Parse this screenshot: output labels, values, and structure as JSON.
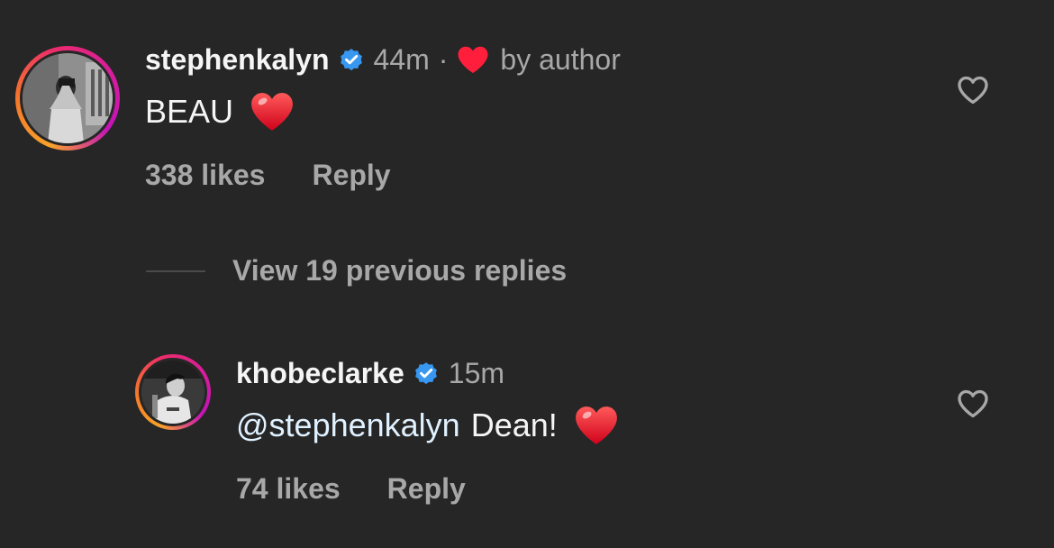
{
  "comments": [
    {
      "username": "stephenkalyn",
      "verified": true,
      "time": "44m",
      "separator": "·",
      "author_badge": "by author",
      "mention": "",
      "text": "BEAU",
      "likes": "338 likes",
      "reply_label": "Reply",
      "avatar_icon": "avatar-photo"
    },
    {
      "username": "khobeclarke",
      "verified": true,
      "time": "15m",
      "mention": "@stephenkalyn",
      "text": "Dean!",
      "likes": "74 likes",
      "reply_label": "Reply",
      "avatar_icon": "avatar-photo"
    }
  ],
  "view_replies_label": "View 19 previous replies",
  "colors": {
    "background": "#262626",
    "primary_text": "#f5f5f5",
    "secondary_text": "#a8a8a8",
    "verified_blue": "#3897f0",
    "heart_red": "#ff1f3d",
    "mention": "#e0f1ff"
  },
  "icons": {
    "verified": "verified-badge-icon",
    "author_heart": "heart-filled-icon",
    "emoji": "red-heart-emoji-icon",
    "like": "heart-outline-icon"
  }
}
